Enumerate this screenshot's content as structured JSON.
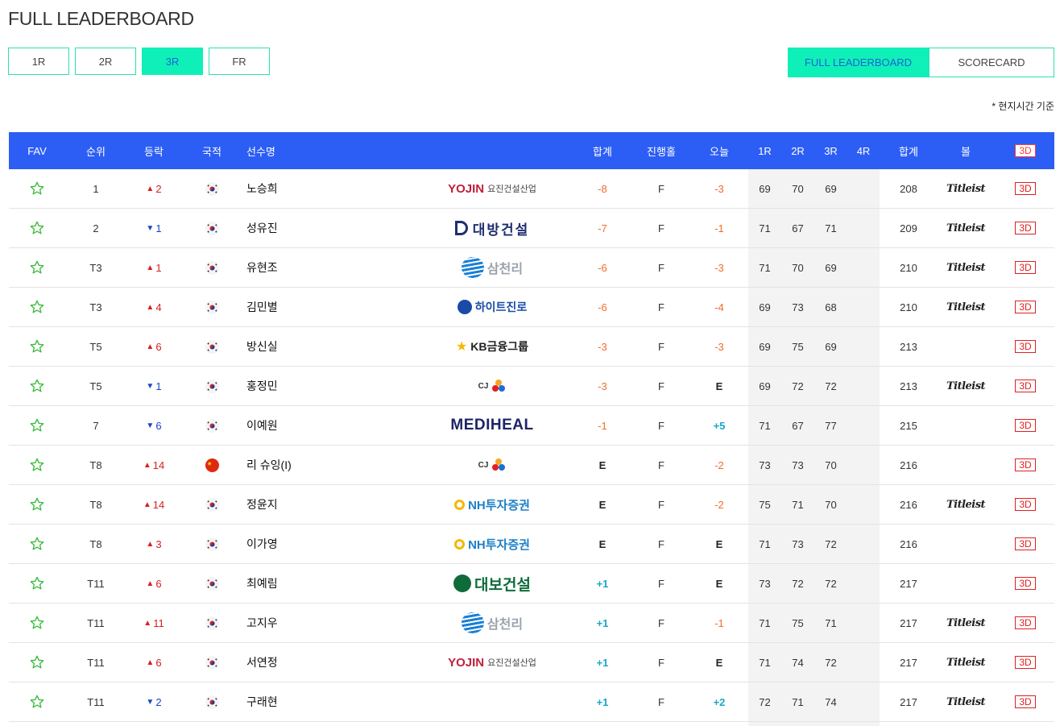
{
  "page": {
    "title": "FULL LEADERBOARD",
    "time_note": "* 현지시간 기준"
  },
  "round_tabs": [
    {
      "label": "1R",
      "active": false
    },
    {
      "label": "2R",
      "active": false
    },
    {
      "label": "3R",
      "active": true
    },
    {
      "label": "FR",
      "active": false
    }
  ],
  "view_toggle": {
    "leaderboard": "FULL LEADERBOARD",
    "scorecard": "SCORECARD"
  },
  "columns": {
    "fav": "FAV",
    "rank": "순위",
    "move": "등락",
    "nation": "국적",
    "name": "선수명",
    "par": "합계",
    "progress": "진행홀",
    "today": "오늘",
    "r1": "1R",
    "r2": "2R",
    "r3": "3R",
    "r4": "4R",
    "total": "합계",
    "ball": "볼",
    "view3d": "3D"
  },
  "colors": {
    "accent": "#0ff0b8",
    "header_bg": "#2c5ef5",
    "under_par": "#f26c2b",
    "over_par": "#1aa7c9",
    "up": "#d62020",
    "down": "#1a44c9"
  },
  "sponsor_text": {
    "yojin": "YOJIN",
    "yojin_sub": "요진건설산업",
    "daebang": "대방건설",
    "samchully": "삼천리",
    "hite": "하이트진로",
    "kb": "KB금융그룹",
    "cj": "CJ",
    "mediheal": "MEDIHEAL",
    "nh": "NH투자증권",
    "daebo": "대보건설"
  },
  "players": [
    {
      "rank": "1",
      "dir": "up",
      "move": "2",
      "nation": "kr",
      "name": "노승희",
      "sponsor": "yojin",
      "par": "-8",
      "progress": "F",
      "today": "-3",
      "r1": "69",
      "r2": "70",
      "r3": "69",
      "r4": "",
      "total": "208",
      "ball": "Titleist"
    },
    {
      "rank": "2",
      "dir": "down",
      "move": "1",
      "nation": "kr",
      "name": "성유진",
      "sponsor": "daebang",
      "par": "-7",
      "progress": "F",
      "today": "-1",
      "r1": "71",
      "r2": "67",
      "r3": "71",
      "r4": "",
      "total": "209",
      "ball": "Titleist"
    },
    {
      "rank": "T3",
      "dir": "up",
      "move": "1",
      "nation": "kr",
      "name": "유현조",
      "sponsor": "samchully",
      "par": "-6",
      "progress": "F",
      "today": "-3",
      "r1": "71",
      "r2": "70",
      "r3": "69",
      "r4": "",
      "total": "210",
      "ball": "Titleist"
    },
    {
      "rank": "T3",
      "dir": "up",
      "move": "4",
      "nation": "kr",
      "name": "김민별",
      "sponsor": "hite",
      "par": "-6",
      "progress": "F",
      "today": "-4",
      "r1": "69",
      "r2": "73",
      "r3": "68",
      "r4": "",
      "total": "210",
      "ball": "Titleist"
    },
    {
      "rank": "T5",
      "dir": "up",
      "move": "6",
      "nation": "kr",
      "name": "방신실",
      "sponsor": "kb",
      "par": "-3",
      "progress": "F",
      "today": "-3",
      "r1": "69",
      "r2": "75",
      "r3": "69",
      "r4": "",
      "total": "213",
      "ball": ""
    },
    {
      "rank": "T5",
      "dir": "down",
      "move": "1",
      "nation": "kr",
      "name": "홍정민",
      "sponsor": "cj",
      "par": "-3",
      "progress": "F",
      "today": "E",
      "r1": "69",
      "r2": "72",
      "r3": "72",
      "r4": "",
      "total": "213",
      "ball": "Titleist"
    },
    {
      "rank": "7",
      "dir": "down",
      "move": "6",
      "nation": "kr",
      "name": "이예원",
      "sponsor": "mediheal",
      "par": "-1",
      "progress": "F",
      "today": "+5",
      "r1": "71",
      "r2": "67",
      "r3": "77",
      "r4": "",
      "total": "215",
      "ball": ""
    },
    {
      "rank": "T8",
      "dir": "up",
      "move": "14",
      "nation": "cn",
      "name": "리 슈잉(I)",
      "sponsor": "cj",
      "par": "E",
      "progress": "F",
      "today": "-2",
      "r1": "73",
      "r2": "73",
      "r3": "70",
      "r4": "",
      "total": "216",
      "ball": ""
    },
    {
      "rank": "T8",
      "dir": "up",
      "move": "14",
      "nation": "kr",
      "name": "정윤지",
      "sponsor": "nh",
      "par": "E",
      "progress": "F",
      "today": "-2",
      "r1": "75",
      "r2": "71",
      "r3": "70",
      "r4": "",
      "total": "216",
      "ball": "Titleist"
    },
    {
      "rank": "T8",
      "dir": "up",
      "move": "3",
      "nation": "kr",
      "name": "이가영",
      "sponsor": "nh",
      "par": "E",
      "progress": "F",
      "today": "E",
      "r1": "71",
      "r2": "73",
      "r3": "72",
      "r4": "",
      "total": "216",
      "ball": ""
    },
    {
      "rank": "T11",
      "dir": "up",
      "move": "6",
      "nation": "kr",
      "name": "최예림",
      "sponsor": "daebo",
      "par": "+1",
      "progress": "F",
      "today": "E",
      "r1": "73",
      "r2": "72",
      "r3": "72",
      "r4": "",
      "total": "217",
      "ball": ""
    },
    {
      "rank": "T11",
      "dir": "up",
      "move": "11",
      "nation": "kr",
      "name": "고지우",
      "sponsor": "samchully",
      "par": "+1",
      "progress": "F",
      "today": "-1",
      "r1": "71",
      "r2": "75",
      "r3": "71",
      "r4": "",
      "total": "217",
      "ball": "Titleist"
    },
    {
      "rank": "T11",
      "dir": "up",
      "move": "6",
      "nation": "kr",
      "name": "서연정",
      "sponsor": "yojin",
      "par": "+1",
      "progress": "F",
      "today": "E",
      "r1": "71",
      "r2": "74",
      "r3": "72",
      "r4": "",
      "total": "217",
      "ball": "Titleist"
    },
    {
      "rank": "T11",
      "dir": "down",
      "move": "2",
      "nation": "kr",
      "name": "구래현",
      "sponsor": "",
      "par": "+1",
      "progress": "F",
      "today": "+2",
      "r1": "72",
      "r2": "71",
      "r3": "74",
      "r4": "",
      "total": "217",
      "ball": "Titleist"
    }
  ]
}
